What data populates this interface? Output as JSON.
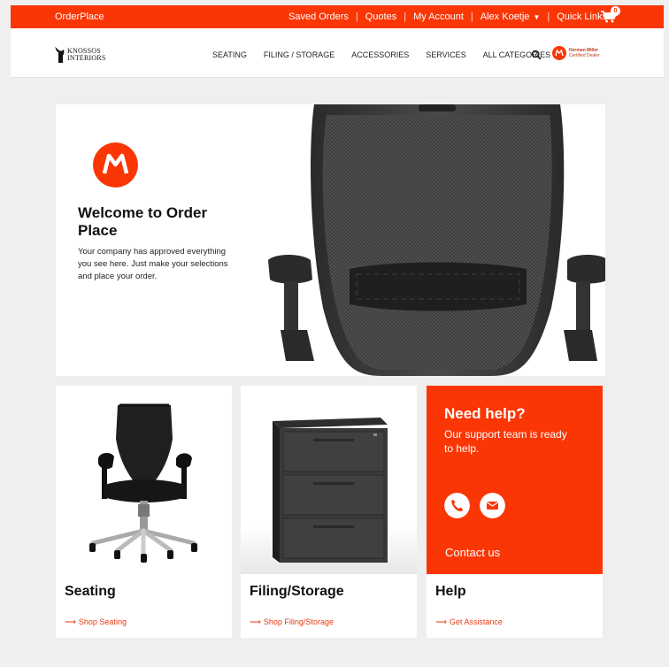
{
  "topbar": {
    "brand": "OrderPlace",
    "links": [
      "Saved Orders",
      "Quotes",
      "My Account",
      "Alex Koetje",
      "Quick Links"
    ],
    "cart_count": "0"
  },
  "navbar": {
    "logo_line1": "KNOSSOS",
    "logo_line2": "INTERIORS",
    "items": [
      "SEATING",
      "FILING / STORAGE",
      "ACCESSORIES",
      "SERVICES",
      "ALL CATEGORIES"
    ],
    "dealer_line1": "Herman Miller",
    "dealer_line2": "Certified Dealer"
  },
  "hero": {
    "title": "Welcome to Order Place",
    "body": "Your company has approved everything you see here. Just make your selections and place your order."
  },
  "cards": [
    {
      "title": "Seating",
      "link": "Shop Seating"
    },
    {
      "title": "Filing/Storage",
      "link": "Shop Filing/Storage"
    },
    {
      "title": "Help",
      "link": "Get Assistance"
    }
  ],
  "help": {
    "heading": "Need help?",
    "sub": "Our support team is ready to help.",
    "contact": "Contact us"
  },
  "colors": {
    "accent": "#fa3605",
    "link": "#e53a10",
    "background": "#efefef"
  }
}
